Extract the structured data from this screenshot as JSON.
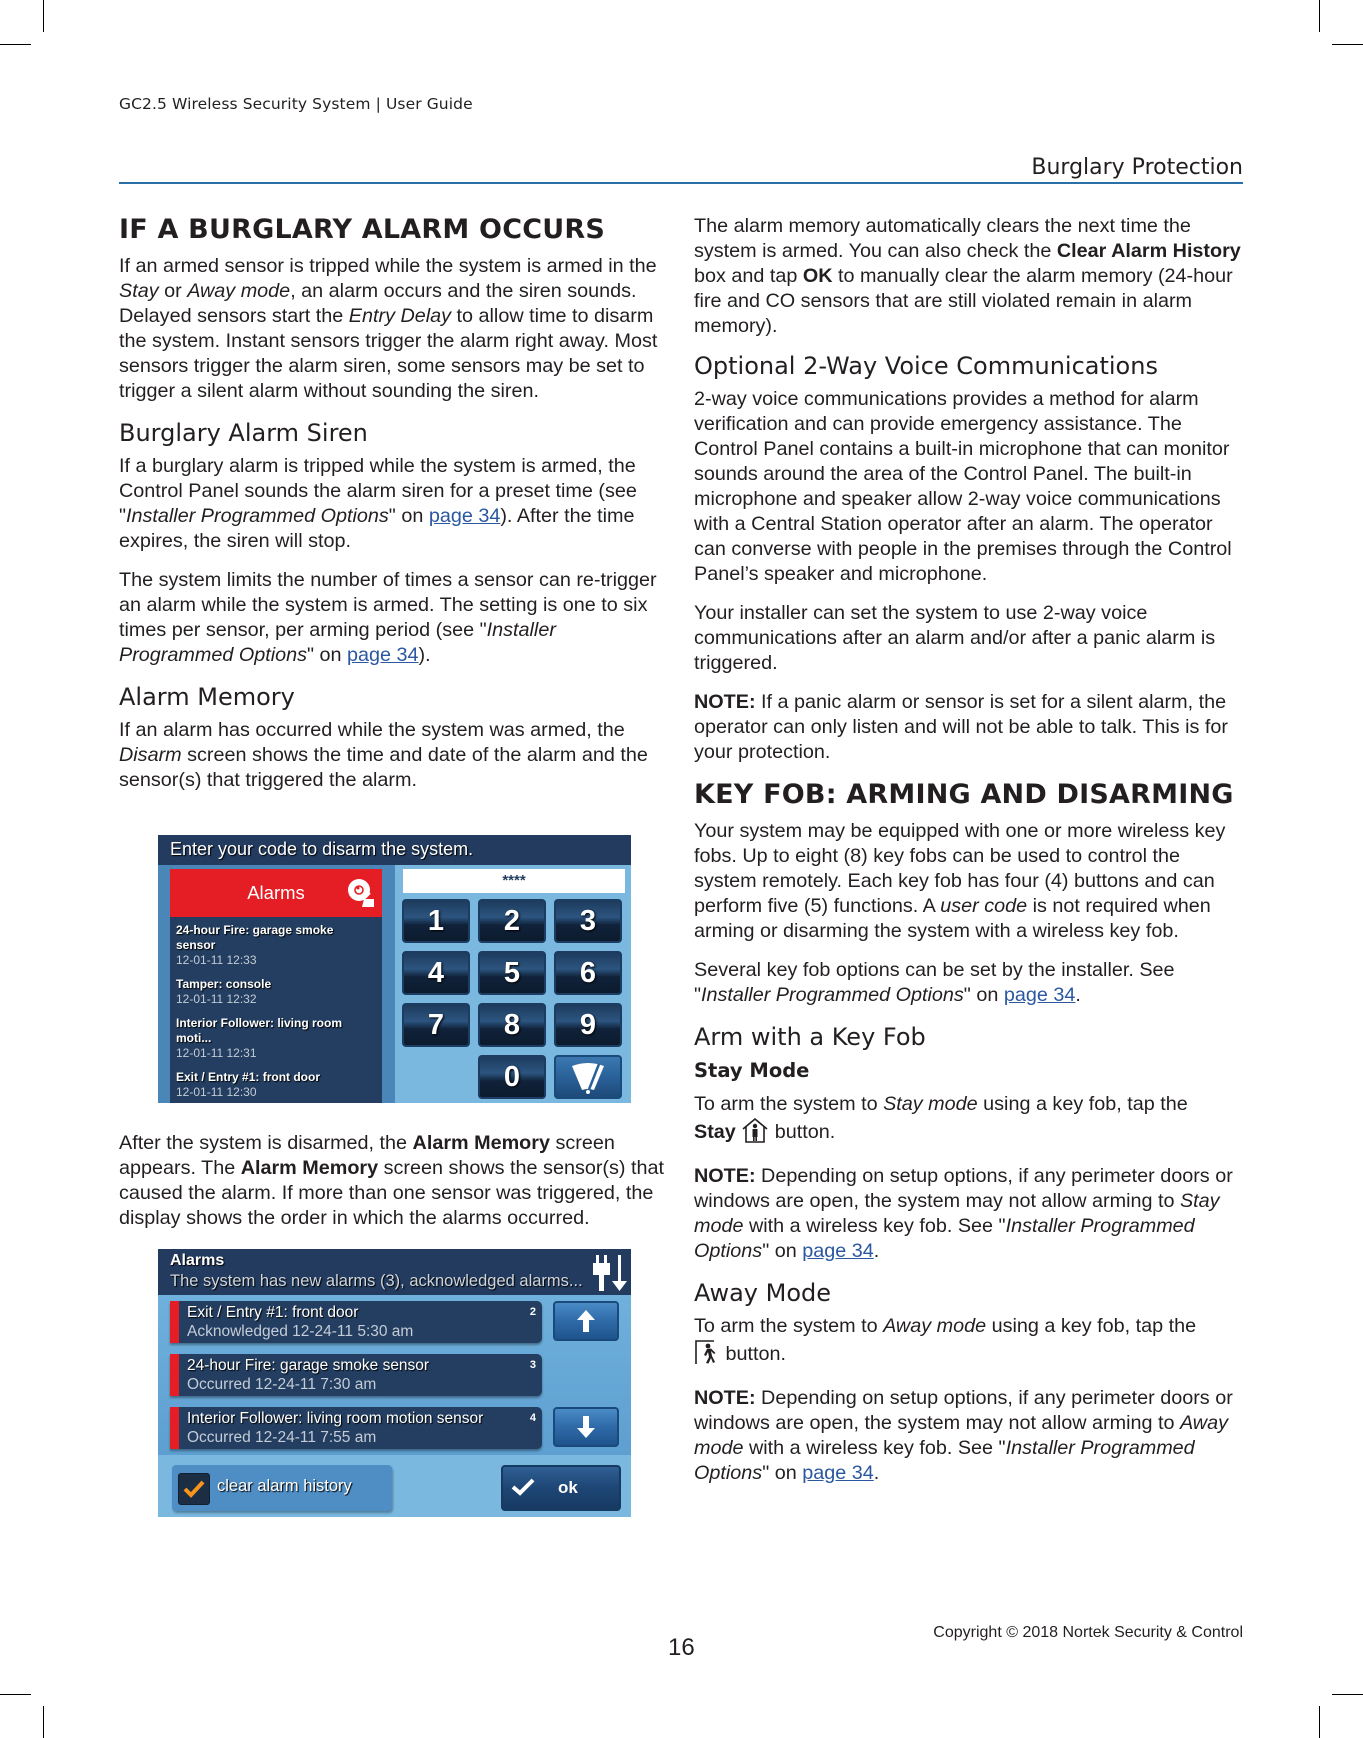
{
  "header": {
    "doc_title": "GC2.5 Wireless Security System | User Guide",
    "section_title": "Burglary Protection",
    "rule_color": "#2a6fa8"
  },
  "left": {
    "h1": "IF A BURGLARY ALARM OCCURS",
    "p1": {
      "a": "If an armed sensor is tripped while the system is armed in the ",
      "i1": "Stay",
      "b": " or ",
      "i2": "Away mode",
      "c": ", an alarm occurs and the siren sounds. Delayed sensors start the ",
      "i3": "Entry Delay",
      "d": " to allow time to disarm the system. Instant sensors trigger the alarm right away. Most sensors trigger the alarm siren, some sensors may be set to trigger a silent alarm without sounding the siren."
    },
    "h2_siren": "Burglary Alarm Siren",
    "p2": {
      "a": "If a burglary alarm is tripped while the system is armed, the Control Panel sounds the alarm siren for a preset time (see \"",
      "i": "Installer Programmed Options",
      "b": "\" on ",
      "link": "page 34",
      "c": "). After the time expires, the siren will stop."
    },
    "p3": {
      "a": "The system limits the number of times a sensor can re-trigger an alarm while the system is armed. The setting is one to six times per sensor, per arming period (see \"",
      "i": "Installer Programmed Options",
      "b": "\" on ",
      "link": "page 34",
      "c": ")."
    },
    "h2_memory": "Alarm Memory",
    "p4": {
      "a": "If an alarm has occurred while the system was armed, the ",
      "i": "Disarm",
      "b": " screen shows the time and date of the alarm and the sensor(s) that triggered the alarm."
    },
    "disarm_screen": {
      "title": "Enter your code to disarm the system.",
      "alarms_label": "Alarms",
      "code_value": "****",
      "alarms": [
        {
          "name": "24-hour Fire: garage smoke sensor",
          "time": "12-01-11 12:33"
        },
        {
          "name": "Tamper: console",
          "time": "12-01-11 12:32"
        },
        {
          "name": "Interior Follower: living room moti...",
          "time": "12-01-11 12:31"
        },
        {
          "name": "Exit / Entry #1: front door",
          "time": "12-01-11 12:30"
        }
      ],
      "keys": [
        "1",
        "2",
        "3",
        "4",
        "5",
        "6",
        "7",
        "8",
        "9",
        "",
        "0",
        "clear"
      ],
      "alarm_color": "#e51e25"
    },
    "p5": {
      "a": "After the system is disarmed, the ",
      "b1": "Alarm Memory",
      "b": " screen appears. The ",
      "b2": "Alarm Memory",
      "c": " screen shows the sensor(s) that caused the alarm. If more than one sensor was triggered, the display shows the order in which the alarms occurred."
    },
    "memory_screen": {
      "title": "Alarms",
      "subtitle": "The system has new alarms (3), acknowledged alarms...",
      "rows": [
        {
          "name": "Exit / Entry #1: front door",
          "status": "Acknowledged 12-24-11 5:30 am",
          "num": "2"
        },
        {
          "name": "24-hour Fire: garage smoke sensor",
          "status": "Occurred 12-24-11 7:30 am",
          "num": "3"
        },
        {
          "name": "Interior Follower: living room motion sensor",
          "status": "Occurred 12-24-11 7:55 am",
          "num": "4"
        }
      ],
      "clear_label": "clear alarm history",
      "clear_checked": true,
      "ok_label": "ok"
    }
  },
  "right": {
    "p1": {
      "a": "The alarm memory automatically clears the next time the system is armed. You can also check the ",
      "b1": "Clear Alarm History",
      "b": " box and tap ",
      "b2": "OK",
      "c": " to manually clear the alarm memory (24-hour fire and CO sensors that are still violated remain in alarm memory)."
    },
    "h2_voice": "Optional 2-Way Voice Communications",
    "p2": "2-way voice communications provides a method for alarm verification and can provide emergency assistance. The Control Panel contains a built-in microphone that can monitor sounds around the area of the Control Panel. The built-in microphone and speaker allow 2-way voice communications with a Central Station operator after an alarm. The operator can converse with people in the premises through the Control Panel’s speaker and microphone.",
    "p3": "Your installer can set the system to use 2-way voice communications after an alarm and/or after a panic alarm is triggered.",
    "p4": {
      "label": "NOTE:",
      "text": " If a panic alarm or sensor is set for a silent alarm, the operator can only listen and will not be able to talk. This is for your protection."
    },
    "h1_keyfob": "KEY FOB: ARMING AND DISARMING",
    "p5": {
      "a": "Your system may be equipped with one or more wireless key fobs. Up to eight (8) key fobs can be used to control the system remotely. Each key fob has four (4) buttons and can perform five (5) functions. A ",
      "i": "user code",
      "b": " is not required when arming or disarming the system with a wireless key fob."
    },
    "p6": {
      "a": "Several key fob options can be set by the installer. See \"",
      "i": "Installer Programmed Options",
      "b": "\" on ",
      "link": "page 34",
      "c": "."
    },
    "h2_arm": "Arm with a Key Fob",
    "h3_stay": "Stay Mode",
    "p7": {
      "a": "To arm the system to ",
      "i": "Stay mode",
      "b": " using a key fob, tap the ",
      "bold": "Stay",
      "c": " button."
    },
    "p8": {
      "label": "NOTE:",
      "a": " Depending on setup options, if any perimeter doors or windows are open, the system may not allow arming to ",
      "i1": "Stay mode",
      "b": " with a wireless key fob. See \"",
      "i2": "Installer Programmed Options",
      "c": "\" on ",
      "link": "page 34",
      "d": "."
    },
    "h2_away": "Away Mode",
    "p9": {
      "a": "To arm the system to ",
      "i": "Away mode",
      "b": " using a key fob, tap the ",
      "c": " button."
    },
    "p10": {
      "label": "NOTE:",
      "a": " Depending on setup options, if any perimeter doors or windows are open, the system may not allow arming to ",
      "i1": "Away mode",
      "b": " with a wireless key fob. See \"",
      "i2": "Installer Programmed Options",
      "c": "\" on ",
      "link": "page 34",
      "d": "."
    }
  },
  "footer": {
    "page_number": "16",
    "copyright": "Copyright ©  2018 Nortek Security & Control"
  }
}
